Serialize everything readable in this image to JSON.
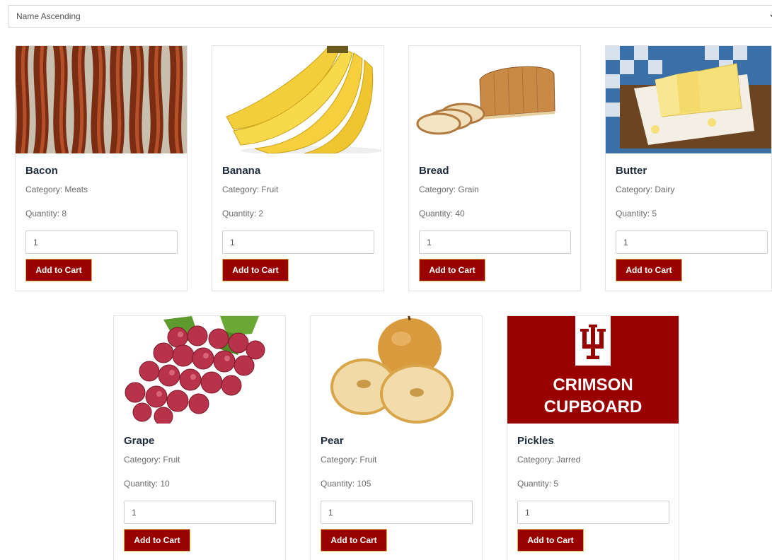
{
  "sort": {
    "selected": "Name Ascending"
  },
  "colors": {
    "accent": "#990000",
    "accent_border": "#d9b54a",
    "logo_bg": "#990000"
  },
  "products": [
    {
      "name": "Bacon",
      "category": "Category: Meats",
      "quantity": "Quantity: 8",
      "input_value": "1",
      "button_label": "Add to Cart",
      "image": "bacon-image"
    },
    {
      "name": "Banana",
      "category": "Category: Fruit",
      "quantity": "Quantity: 2",
      "input_value": "1",
      "button_label": "Add to Cart",
      "image": "banana-image"
    },
    {
      "name": "Bread",
      "category": "Category: Grain",
      "quantity": "Quantity: 40",
      "input_value": "1",
      "button_label": "Add to Cart",
      "image": "bread-image"
    },
    {
      "name": "Butter",
      "category": "Category: Dairy",
      "quantity": "Quantity: 5",
      "input_value": "1",
      "button_label": "Add to Cart",
      "image": "butter-image"
    },
    {
      "name": "Grape",
      "category": "Category: Fruit",
      "quantity": "Quantity: 10",
      "input_value": "1",
      "button_label": "Add to Cart",
      "image": "grape-image"
    },
    {
      "name": "Pear",
      "category": "Category: Fruit",
      "quantity": "Quantity: 105",
      "input_value": "1",
      "button_label": "Add to Cart",
      "image": "pear-image"
    },
    {
      "name": "Pickles",
      "category": "Category: Jarred",
      "quantity": "Quantity: 5",
      "input_value": "1",
      "button_label": "Add to Cart",
      "image": "crimson-cupboard-logo"
    }
  ],
  "logo": {
    "line1": "CRIMSON",
    "line2": "CUPBOARD"
  }
}
